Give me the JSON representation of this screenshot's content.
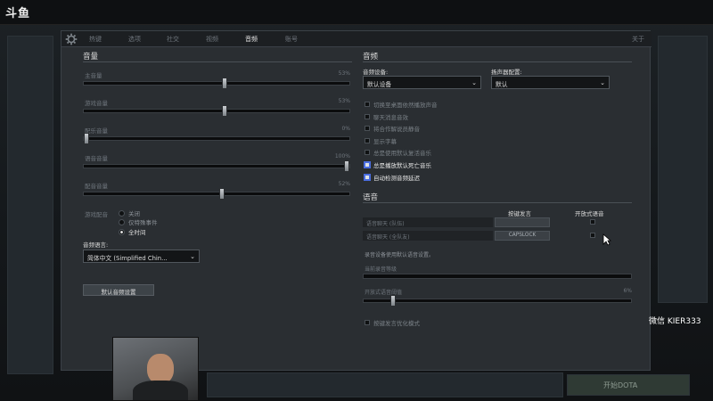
{
  "stream": {
    "logo_text": "斗鱼",
    "watermark": "微信 KIER333"
  },
  "background": {
    "play_button": "开始DOTA"
  },
  "tabs": [
    "热键",
    "选项",
    "社交",
    "视频",
    "音频",
    "账号"
  ],
  "active_tab": "音频",
  "close_label": "关于",
  "volume": {
    "title": "音量",
    "sliders": [
      {
        "label": "主音量",
        "value": "53%",
        "pct": 53
      },
      {
        "label": "游戏音量",
        "value": "53%",
        "pct": 53
      },
      {
        "label": "配乐音量",
        "value": "0%",
        "pct": 0
      },
      {
        "label": "语音音量",
        "value": "100%",
        "pct": 100
      },
      {
        "label": "配音音量",
        "value": "52%",
        "pct": 52
      }
    ]
  },
  "announcer": {
    "label": "游戏配音",
    "options": [
      "关闭",
      "仅特殊事件",
      "全时间"
    ],
    "selected_index": 2
  },
  "audio_language": {
    "label": "音频语言:",
    "value": "简体中文 (Simplified Chin..."
  },
  "default_button": "默认音频设置",
  "audio": {
    "title": "音频",
    "device_label": "音频设备:",
    "device_value": "默认设备",
    "speaker_label": "扬声器配置:",
    "speaker_value": "默认",
    "checkboxes": [
      {
        "label": "切换至桌面依然播放声音",
        "checked": false
      },
      {
        "label": "聊天消息音效",
        "checked": false
      },
      {
        "label": "将合作解说员静音",
        "checked": false
      },
      {
        "label": "显示字幕",
        "checked": false
      },
      {
        "label": "总是使用默认复活音乐",
        "checked": false
      },
      {
        "label": "总是播放默认死亡音乐",
        "checked": true
      },
      {
        "label": "自动检测音频延迟",
        "checked": true
      }
    ]
  },
  "voice": {
    "title": "语音",
    "col_ptt": "按键发言",
    "col_open": "开放式语音",
    "rows": [
      {
        "label": "语音聊天 (队伍)",
        "key": ""
      },
      {
        "label": "语音聊天 (全队友)",
        "key": "CAPSLOCK"
      }
    ],
    "record_device_note": "录音设备使用默认语音设置。",
    "current_level_label": "当前录音等级",
    "threshold_label": "开放式语音阈值",
    "threshold_value": "6%",
    "threshold_pct": 6,
    "ptt_opt_label": "按键发言优化模式"
  }
}
